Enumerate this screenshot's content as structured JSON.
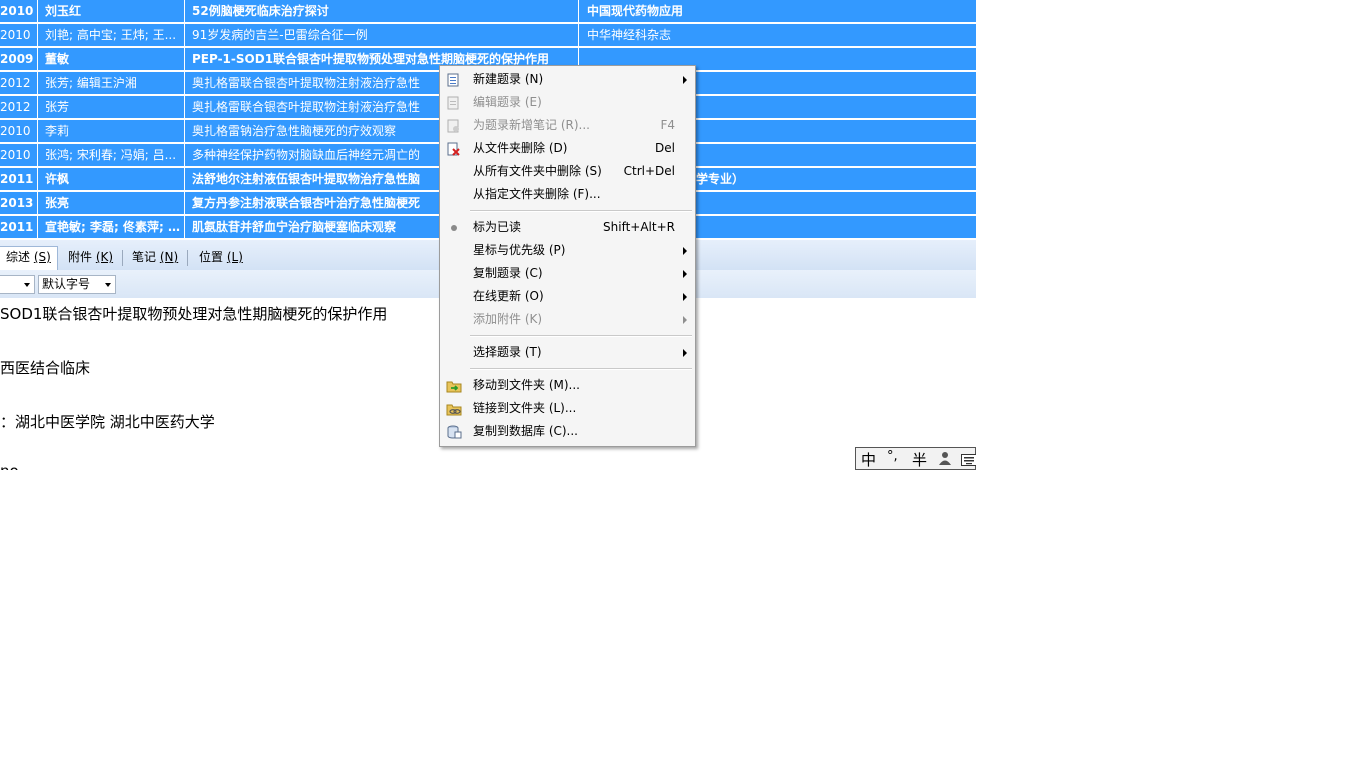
{
  "table": {
    "rows": [
      {
        "year": "2010",
        "author": "刘玉红",
        "title": "52例脑梗死临床治疗探讨",
        "journal": "中国现代药物应用",
        "bold": true
      },
      {
        "year": "2010",
        "author": "刘艳; 高中宝; 王炜; 王...",
        "title": "91岁发病的吉兰-巴雷综合征一例",
        "journal": "中华神经科杂志",
        "bold": false
      },
      {
        "year": "2009",
        "author": "董敏",
        "title": "PEP-1-SOD1联合银杏叶提取物预处理对急性期脑梗死的保护作用",
        "journal": "",
        "bold": true
      },
      {
        "year": "2012",
        "author": "张芳; 编辑王沪湘",
        "title": "奥扎格雷联合银杏叶提取物注射液治疗急性",
        "journal": "",
        "bold": false
      },
      {
        "year": "2012",
        "author": "张芳",
        "title": "奥扎格雷联合银杏叶提取物注射液治疗急性",
        "journal": "",
        "bold": false
      },
      {
        "year": "2010",
        "author": "李莉",
        "title": "奥扎格雷钠治疗急性脑梗死的疗效观察",
        "journal": "",
        "bold": false
      },
      {
        "year": "2010",
        "author": "张鸿; 宋利春; 冯娟; 吕...",
        "title": "多种神经保护药物对脑缺血后神经元凋亡的",
        "journal": "",
        "bold": false
      },
      {
        "year": "2011",
        "author": "许枫",
        "title": "法舒地尔注射液伍银杏叶提取物治疗急性脑",
        "journal": "学专业）",
        "bold": true
      },
      {
        "year": "2013",
        "author": "张亮",
        "title": "复方丹参注射液联合银杏叶治疗急性脑梗死",
        "journal": "",
        "bold": true
      },
      {
        "year": "2011",
        "author": "宣艳敏; 李磊; 佟素萍; ...",
        "title": "肌氨肽苷并舒血宁治疗脑梗塞临床观察",
        "journal": "",
        "bold": true
      }
    ]
  },
  "tabs": [
    {
      "label": "综述",
      "key": "(S)"
    },
    {
      "label": "附件",
      "key": "(K)"
    },
    {
      "label": "笔记",
      "key": "(N)"
    },
    {
      "label": "位置",
      "key": "(L)"
    }
  ],
  "toolbar": {
    "font_size_label": "默认字号"
  },
  "detail": {
    "title": "SOD1联合银杏叶提取物预处理对急性期脑梗死的保护作用",
    "journal": "西医结合临床",
    "institution": "：湖北中医学院 湖北中医药大学",
    "partial": "no"
  },
  "context_menu": {
    "items": [
      {
        "label": "新建题录 (N)",
        "shortcut": "",
        "submenu": true,
        "disabled": false,
        "icon": "new-record-icon"
      },
      {
        "label": "编辑题录 (E)",
        "shortcut": "",
        "submenu": false,
        "disabled": true,
        "icon": "edit-record-icon"
      },
      {
        "label": "为题录新增笔记 (R)...",
        "shortcut": "F4",
        "submenu": false,
        "disabled": true,
        "icon": "add-note-icon"
      },
      {
        "label": "从文件夹删除 (D)",
        "shortcut": "Del",
        "submenu": false,
        "disabled": false,
        "icon": "delete-from-folder-icon"
      },
      {
        "label": "从所有文件夹中删除 (S)",
        "shortcut": "Ctrl+Del",
        "submenu": false,
        "disabled": false,
        "icon": ""
      },
      {
        "label": "从指定文件夹删除 (F)...",
        "shortcut": "",
        "submenu": false,
        "disabled": false,
        "icon": ""
      },
      {
        "label": "标为已读",
        "shortcut": "Shift+Alt+R",
        "submenu": false,
        "disabled": false,
        "icon": "read-dot-icon"
      },
      {
        "label": "星标与优先级 (P)",
        "shortcut": "",
        "submenu": true,
        "disabled": false,
        "icon": ""
      },
      {
        "label": "复制题录 (C)",
        "shortcut": "",
        "submenu": true,
        "disabled": false,
        "icon": ""
      },
      {
        "label": "在线更新 (O)",
        "shortcut": "",
        "submenu": true,
        "disabled": false,
        "icon": ""
      },
      {
        "label": "添加附件 (K)",
        "shortcut": "",
        "submenu": true,
        "disabled": true,
        "icon": ""
      },
      {
        "label": "选择题录 (T)",
        "shortcut": "",
        "submenu": true,
        "disabled": false,
        "icon": ""
      },
      {
        "label": "移动到文件夹 (M)...",
        "shortcut": "",
        "submenu": false,
        "disabled": false,
        "icon": "move-to-folder-icon"
      },
      {
        "label": "链接到文件夹 (L)...",
        "shortcut": "",
        "submenu": false,
        "disabled": false,
        "icon": "link-to-folder-icon"
      },
      {
        "label": "复制到数据库 (C)...",
        "shortcut": "",
        "submenu": false,
        "disabled": false,
        "icon": "copy-to-database-icon"
      }
    ]
  },
  "ime": {
    "mode": "中",
    "punct": "°,",
    "width": "半"
  },
  "colors": {
    "selection": "#3399ff",
    "menu_bg": "#f5f5f5"
  }
}
